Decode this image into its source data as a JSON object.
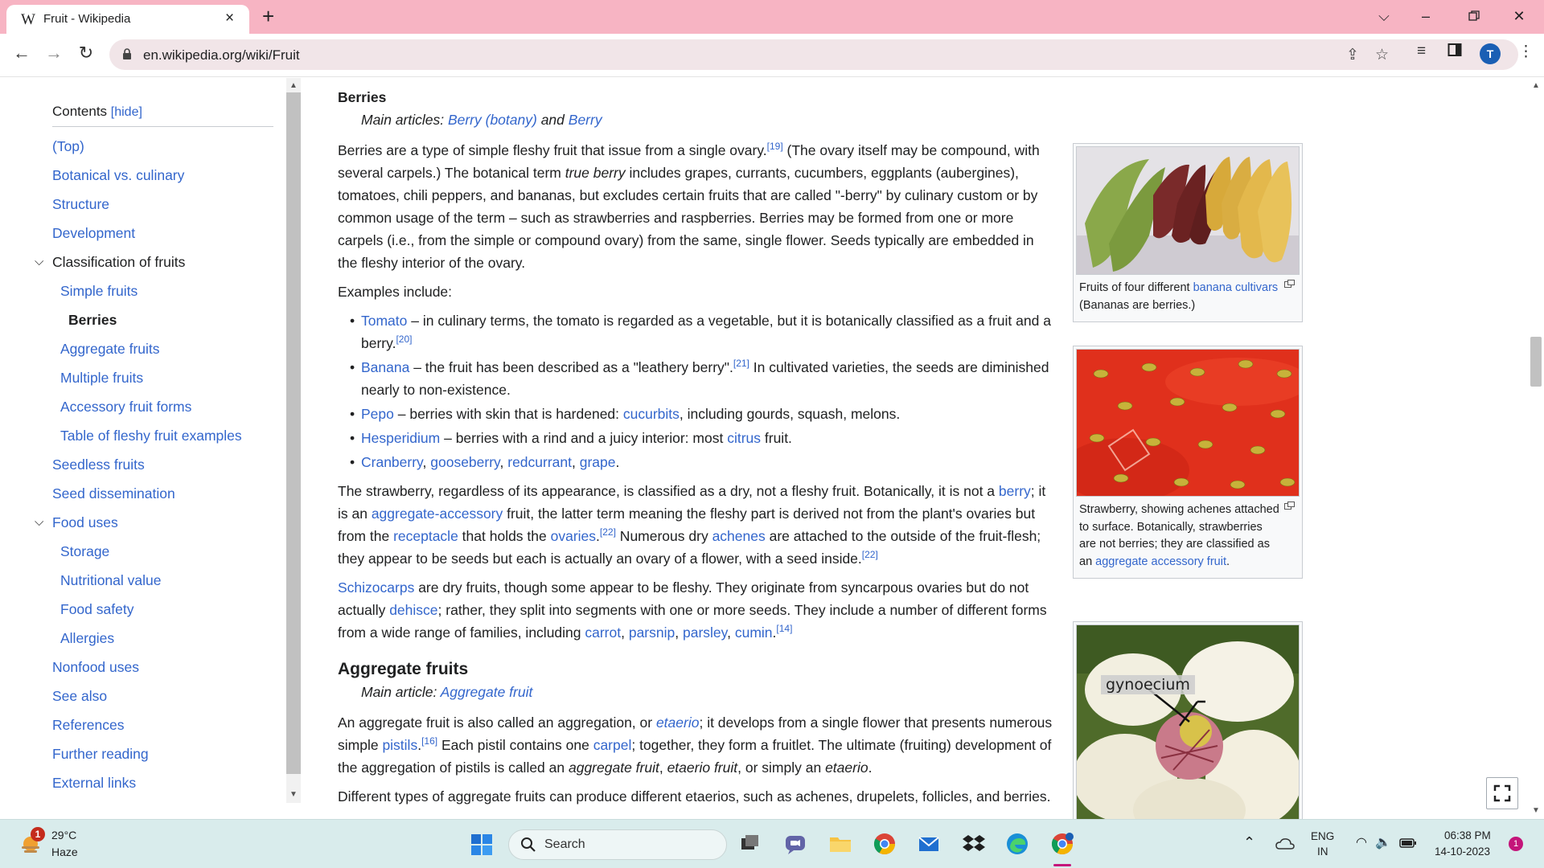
{
  "browser": {
    "tab_title": "Fruit - Wikipedia",
    "tab_favicon": "W",
    "url": "en.wikipedia.org/wiki/Fruit",
    "profile_initial": "T"
  },
  "toc": {
    "title": "Contents",
    "hide_label": "[hide]",
    "items": [
      {
        "label": "(Top)"
      },
      {
        "label": "Botanical vs. culinary"
      },
      {
        "label": "Structure"
      },
      {
        "label": "Development"
      },
      {
        "label": "Classification of fruits"
      },
      {
        "label": "Simple fruits"
      },
      {
        "label": "Berries"
      },
      {
        "label": "Aggregate fruits"
      },
      {
        "label": "Multiple fruits"
      },
      {
        "label": "Accessory fruit forms"
      },
      {
        "label": "Table of fleshy fruit examples"
      },
      {
        "label": "Seedless fruits"
      },
      {
        "label": "Seed dissemination"
      },
      {
        "label": "Food uses"
      },
      {
        "label": "Storage"
      },
      {
        "label": "Nutritional value"
      },
      {
        "label": "Food safety"
      },
      {
        "label": "Allergies"
      },
      {
        "label": "Nonfood uses"
      },
      {
        "label": "See also"
      },
      {
        "label": "References"
      },
      {
        "label": "Further reading"
      },
      {
        "label": "External links"
      }
    ]
  },
  "article": {
    "berries_heading": "Berries",
    "berries_hat_prefix": "Main articles: ",
    "berries_hat_link1": "Berry (botany)",
    "berries_hat_and": " and ",
    "berries_hat_link2": "Berry",
    "p1_a": "Berries are a type of simple fleshy fruit that issue from a single ovary.",
    "p1_ref": "[19]",
    "p1_b": " (The ovary itself may be compound, with several carpels.) The botanical term ",
    "p1_em": "true berry",
    "p1_c": " includes grapes, currants, cucumbers, eggplants (aubergines), tomatoes, chili peppers, and bananas, but excludes certain fruits that are called \"-berry\" by culinary custom or by common usage of the term – such as strawberries and raspberries. Berries may be formed from one or more carpels (i.e., from the simple or compound ovary) from the same, single flower. Seeds typically are embedded in the fleshy interior of the ovary.",
    "examples_intro": "Examples include:",
    "ex1_link": "Tomato",
    "ex1_text": " – in culinary terms, the tomato is regarded as a vegetable, but it is botanically classified as a fruit and a berry.",
    "ex1_ref": "[20]",
    "ex2_link": "Banana",
    "ex2_text_a": " – the fruit has been described as a \"leathery berry\".",
    "ex2_ref": "[21]",
    "ex2_text_b": " In cultivated varieties, the seeds are diminished nearly to non-existence.",
    "ex3_link": "Pepo",
    "ex3_text_a": " – berries with skin that is hardened: ",
    "ex3_link2": "cucurbits",
    "ex3_text_b": ", including gourds, squash, melons.",
    "ex4_link": "Hesperidium",
    "ex4_text_a": " – berries with a rind and a juicy interior: most ",
    "ex4_link2": "citrus",
    "ex4_text_b": " fruit.",
    "ex5_link1": "Cranberry",
    "ex5_link2": "gooseberry",
    "ex5_link3": "redcurrant",
    "ex5_link4": "grape",
    "sep_comma": ", ",
    "period": ".",
    "p2_a": "The strawberry, regardless of its appearance, is classified as a dry, not a fleshy fruit. Botanically, it is not a ",
    "p2_link1": "berry",
    "p2_b": "; it is an ",
    "p2_link2": "aggregate-accessory",
    "p2_c": " fruit, the latter term meaning the fleshy part is derived not from the plant's ovaries but from the ",
    "p2_link3": "receptacle",
    "p2_d": " that holds the ",
    "p2_link4": "ovaries",
    "p2_e": ".",
    "p2_ref1": "[22]",
    "p2_f": " Numerous dry ",
    "p2_link5": "achenes",
    "p2_g": " are attached to the outside of the fruit-flesh; they appear to be seeds but each is actually an ovary of a flower, with a seed inside.",
    "p2_ref2": "[22]",
    "p3_link1": "Schizocarps",
    "p3_a": " are dry fruits, though some appear to be fleshy. They originate from syncarpous ovaries but do not actually ",
    "p3_link2": "dehisce",
    "p3_b": "; rather, they split into segments with one or more seeds. They include a number of different forms from a wide range of families, including ",
    "p3_link3": "carrot",
    "p3_link4": "parsnip",
    "p3_link5": "parsley",
    "p3_link6": "cumin",
    "p3_ref": "[14]",
    "agg_heading": "Aggregate fruits",
    "agg_hat_prefix": "Main article: ",
    "agg_hat_link": "Aggregate fruit",
    "p4_a": "An aggregate fruit is also called an aggregation, or ",
    "p4_link1": "etaerio",
    "p4_b": "; it develops from a single flower that presents numerous simple ",
    "p4_link2": "pistils",
    "p4_c": ".",
    "p4_ref": "[16]",
    "p4_d": " Each pistil contains one ",
    "p4_link3": "carpel",
    "p4_e": "; together, they form a fruitlet. The ultimate (fruiting) development of the aggregation of pistils is called an ",
    "p4_em1": "aggregate fruit",
    "p4_em2": "etaerio fruit",
    "p4_f": ", or simply an ",
    "p4_em3": "etaerio",
    "p5": "Different types of aggregate fruits can produce different etaerios, such as achenes, drupelets, follicles, and berries."
  },
  "figures": {
    "banana_caption_a": "Fruits of four different ",
    "banana_caption_link": "banana cultivars",
    "banana_caption_b": " (Bananas are berries.)",
    "strawberry_caption_a": "Strawberry, showing achenes attached to surface. Botanically, strawberries are not berries; they are classified as an ",
    "strawberry_caption_link": "aggregate accessory fruit",
    "strawberry_caption_b": ".",
    "magnolia_label": "gynoecium"
  },
  "taskbar": {
    "weather_badge": "1",
    "temperature": "29°C",
    "condition": "Haze",
    "search_label": "Search",
    "language_top": "ENG",
    "language_bottom": "IN",
    "time": "06:38 PM",
    "date": "14-10-2023",
    "notification_count": "1"
  },
  "colors": {
    "tab_bar": "#f7b4c3",
    "link": "#3366cc",
    "taskbar": "#d9ecec"
  }
}
